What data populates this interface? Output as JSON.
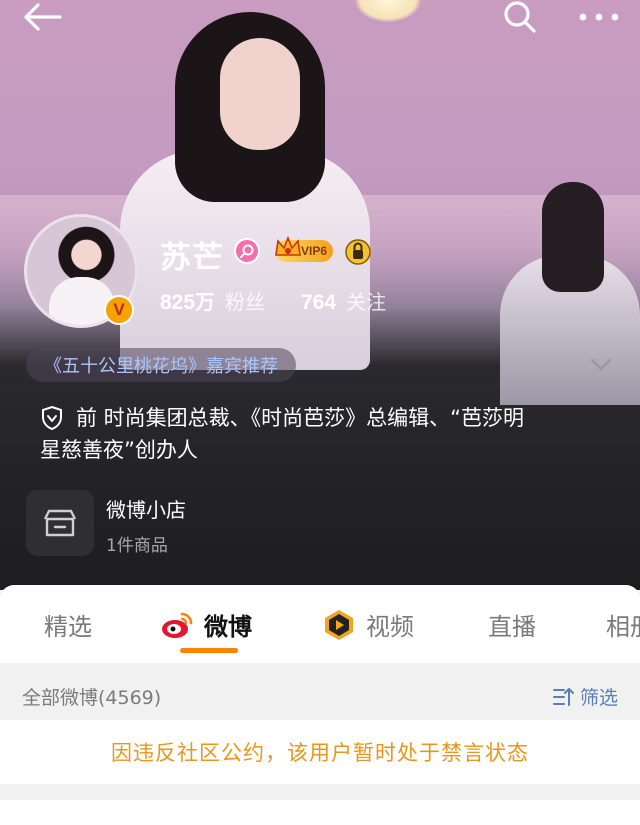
{
  "profile": {
    "name": "苏芒",
    "vip_level": "VIP6",
    "verified_mark": "V",
    "followers_count": "825",
    "followers_unit": "万",
    "followers_label": "粉丝",
    "following_count": "764",
    "following_label": "关注"
  },
  "recommendation": "《五十公里桃花坞》嘉宾推荐",
  "bio": {
    "line1": "前 时尚集团总裁、《时尚芭莎》总编辑、“芭莎明",
    "line2": "星慈善夜”创办人"
  },
  "shop": {
    "title": "微博小店",
    "subtitle": "1件商品"
  },
  "tabs": [
    "精选",
    "微博",
    "视频",
    "直播",
    "相册"
  ],
  "active_tab": "微博",
  "filter_bar": {
    "all_label": "全部微博(4569)",
    "filter_label": "筛选"
  },
  "notice": "因违反社区公约，该用户暂时处于禁言状态",
  "icons": [
    "back-arrow-icon",
    "search-icon",
    "more-icon",
    "chevron-down-icon",
    "shield-icon",
    "store-icon",
    "weibo-logo-icon",
    "video-play-icon",
    "filter-icon"
  ],
  "colors": {
    "accent": "#ff8200",
    "notice": "#e8961e",
    "link": "#5b7eb8"
  }
}
